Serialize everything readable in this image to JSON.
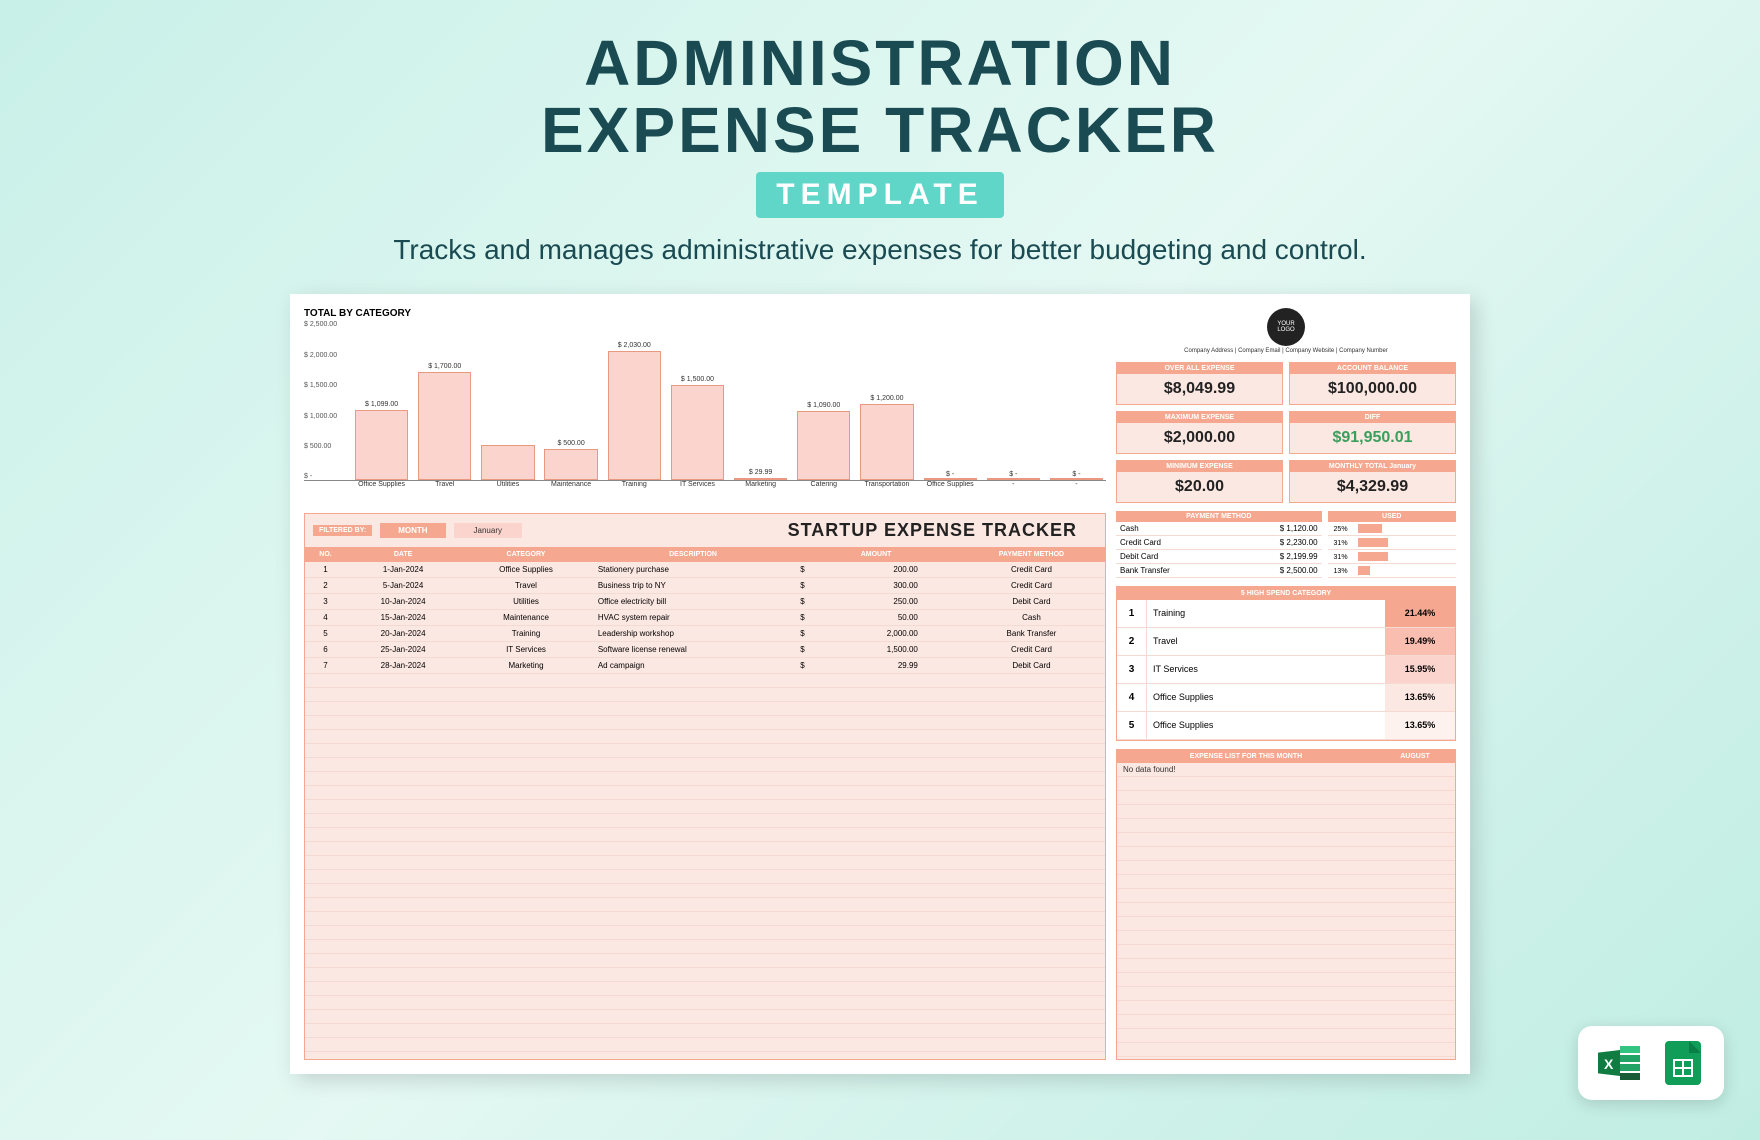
{
  "header": {
    "title_line1": "ADMINISTRATION",
    "title_line2": "EXPENSE TRACKER",
    "badge": "TEMPLATE",
    "subtitle": "Tracks and manages administrative expenses for better budgeting and control."
  },
  "chart_data": {
    "type": "bar",
    "title": "TOTAL BY CATEGORY",
    "ylabel": "",
    "ylim": [
      0,
      2500
    ],
    "yticks": [
      "$ -",
      "$ 500.00",
      "$ 1,000.00",
      "$ 1,500.00",
      "$ 2,000.00",
      "$ 2,500.00"
    ],
    "categories": [
      "Office Supplies",
      "Travel",
      "Utilities",
      "Maintenance",
      "Training",
      "IT Services",
      "Marketing",
      "Catering",
      "Transportation",
      "Office Supplies",
      "-",
      "-"
    ],
    "values": [
      1099,
      1700,
      550,
      500,
      2030,
      1500,
      29.99,
      1090,
      1200,
      0,
      0,
      0
    ],
    "value_labels": [
      "$ 1,099.00",
      "$ 1,700.00",
      "",
      "$ 500.00",
      "$ 2,030.00",
      "$ 1,500.00",
      "$ 29.99",
      "$ 1,090.00",
      "$ 1,200.00",
      "$ -",
      "$ -",
      "$ -"
    ]
  },
  "sheet": {
    "filter_label": "FILTERED BY:",
    "filter_month_label": "MONTH",
    "filter_month_value": "January",
    "title": "STARTUP EXPENSE TRACKER",
    "columns": [
      "NO.",
      "DATE",
      "CATEGORY",
      "DESCRIPTION",
      "AMOUNT",
      "PAYMENT METHOD"
    ],
    "rows": [
      {
        "no": "1",
        "date": "1-Jan-2024",
        "category": "Office Supplies",
        "desc": "Stationery purchase",
        "amount": "200.00",
        "method": "Credit Card"
      },
      {
        "no": "2",
        "date": "5-Jan-2024",
        "category": "Travel",
        "desc": "Business trip to NY",
        "amount": "300.00",
        "method": "Credit Card"
      },
      {
        "no": "3",
        "date": "10-Jan-2024",
        "category": "Utilities",
        "desc": "Office electricity bill",
        "amount": "250.00",
        "method": "Debit Card"
      },
      {
        "no": "4",
        "date": "15-Jan-2024",
        "category": "Maintenance",
        "desc": "HVAC system repair",
        "amount": "50.00",
        "method": "Cash"
      },
      {
        "no": "5",
        "date": "20-Jan-2024",
        "category": "Training",
        "desc": "Leadership workshop",
        "amount": "2,000.00",
        "method": "Bank Transfer"
      },
      {
        "no": "6",
        "date": "25-Jan-2024",
        "category": "IT Services",
        "desc": "Software license renewal",
        "amount": "1,500.00",
        "method": "Credit Card"
      },
      {
        "no": "7",
        "date": "28-Jan-2024",
        "category": "Marketing",
        "desc": "Ad campaign",
        "amount": "29.99",
        "method": "Debit Card"
      }
    ]
  },
  "side": {
    "logo_text_1": "YOUR",
    "logo_text_2": "LOGO",
    "company_meta": "Company Address  |  Company Email  |  Company Website  |  Company Number",
    "stats": [
      {
        "label": "OVER ALL EXPENSE",
        "value": "$8,049.99"
      },
      {
        "label": "ACCOUNT BALANCE",
        "value": "$100,000.00"
      },
      {
        "label": "MAXIMUM EXPENSE",
        "value": "$2,000.00"
      },
      {
        "label": "DIFF",
        "value": "$91,950.01",
        "green": true
      },
      {
        "label": "MINIMUM EXPENSE",
        "value": "$20.00"
      },
      {
        "label": "MONTHLY TOTAL",
        "sublabel": "January",
        "value": "$4,329.99"
      }
    ],
    "payment_header": "PAYMENT METHOD",
    "used_header": "USED",
    "payments": [
      {
        "method": "Cash",
        "amount": "$   1,120.00",
        "pct": "25%",
        "bar": 25
      },
      {
        "method": "Credit Card",
        "amount": "$   2,230.00",
        "pct": "31%",
        "bar": 31
      },
      {
        "method": "Debit Card",
        "amount": "$   2,199.99",
        "pct": "31%",
        "bar": 31
      },
      {
        "method": "Bank Transfer",
        "amount": "$   2,500.00",
        "pct": "13%",
        "bar": 13
      }
    ],
    "high_spend_header": "5 HIGH SPEND CATEGORY",
    "high_spend": [
      {
        "rank": "1",
        "name": "Training",
        "pct": "21.44%"
      },
      {
        "rank": "2",
        "name": "Travel",
        "pct": "19.49%"
      },
      {
        "rank": "3",
        "name": "IT Services",
        "pct": "15.95%"
      },
      {
        "rank": "4",
        "name": "Office Supplies",
        "pct": "13.65%"
      },
      {
        "rank": "5",
        "name": "Office Supplies",
        "pct": "13.65%"
      }
    ],
    "month_list_header": "EXPENSE LIST FOR THIS MONTH",
    "month_list_month": "AUGUST",
    "month_list_empty": "No data found!"
  }
}
